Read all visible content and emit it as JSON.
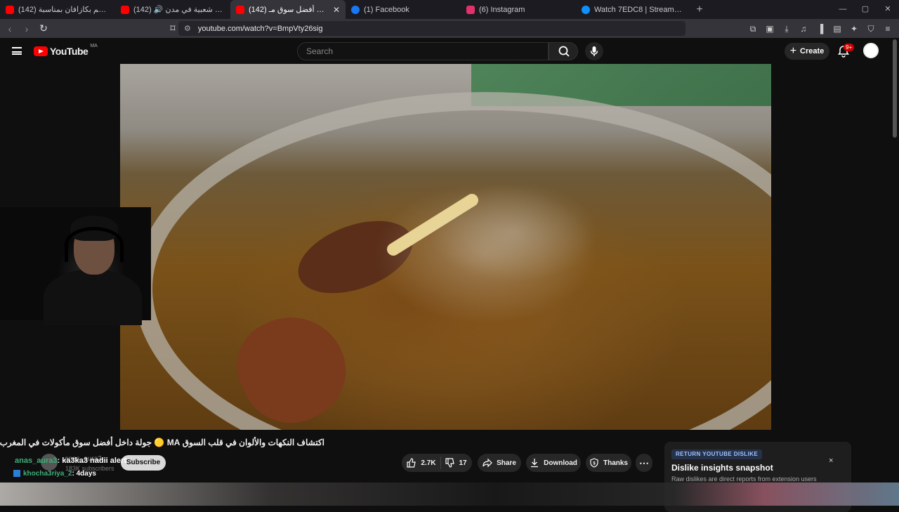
{
  "browser": {
    "tabs": [
      {
        "title": "(142) جمعتهم وفاجئتهم بكازافان بمناسبة",
        "favicon_color": "#ff0000",
        "active": false
      },
      {
        "title": "(142) 🔊 أشهى مأكولات شعبية في مدن",
        "favicon_color": "#ff0000",
        "active": false
      },
      {
        "title": "(142) جولة داخل أفضل سوق مـ...",
        "favicon_color": "#ff0000",
        "active": true
      },
      {
        "title": "(1) Facebook",
        "favicon_color": "#1877f2",
        "active": false
      },
      {
        "title": "(6) Instagram",
        "favicon_color": "#e1306c",
        "active": false
      },
      {
        "title": "Watch 7EDC8 | Streamable",
        "favicon_color": "#0f90fa",
        "active": false
      }
    ],
    "new_tab": "+",
    "url": "youtube.com/watch?v=BmpVty26sig"
  },
  "youtube": {
    "logo_text": "YouTube",
    "country_code": "MA",
    "search_placeholder": "Search",
    "create_label": "Create",
    "notification_count": "9+"
  },
  "video": {
    "title": "اكتشاف النكهات والألوان في قلب السوق MA 🟡 جولة داخل أفضل سوق مأكولات في المغرب",
    "channel_name": "anas_aura3",
    "subscriber_count": "183K subscribers",
    "subscribe_label": "Subscribe",
    "likes": "2.7K",
    "dislikes": "17",
    "share_label": "Share",
    "download_label": "Download",
    "thanks_label": "Thanks",
    "more": "⋯"
  },
  "chat": [
    {
      "user": "anas_aura3",
      "message": ": ka3ka3 nadii alert"
    },
    {
      "user": "khocha3riya_2",
      "message": ": 4days"
    }
  ],
  "dislike_panel": {
    "tag": "RETURN YOUTUBE DISLIKE",
    "title": "Dislike insights snapshot",
    "subtitle": "Raw dislikes are direct reports from extension users",
    "close": "×"
  }
}
